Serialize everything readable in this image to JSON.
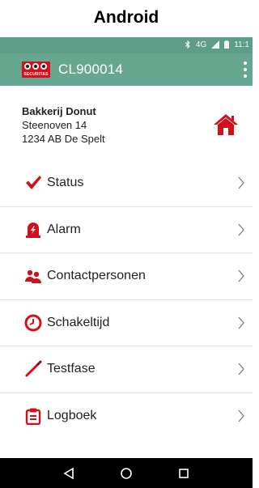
{
  "caption": "Android",
  "status_bar": {
    "bluetooth_icon": "bluetooth-icon",
    "network_label": "4G",
    "signal_icon": "signal-icon",
    "battery_icon": "battery-icon",
    "time": "11:1"
  },
  "app_bar": {
    "logo_icon": "securitas-logo",
    "logo_text": "SECURITAS",
    "title": "CL900014",
    "overflow_icon": "overflow-menu-icon"
  },
  "location": {
    "name": "Bakkerij Donut",
    "street": "Steenoven 14",
    "postal_city": "1234 AB De Spelt",
    "home_icon": "home-icon"
  },
  "menu": [
    {
      "label": "Status",
      "icon": "checkmark-icon",
      "icon_color": "#d0101b"
    },
    {
      "label": "Alarm",
      "icon": "alarm-icon",
      "icon_color": "#d0101b"
    },
    {
      "label": "Contactpersonen",
      "icon": "people-icon",
      "icon_color": "#d0101b"
    },
    {
      "label": "Schakeltijd",
      "icon": "clock-icon",
      "icon_color": "#d0101b"
    },
    {
      "label": "Testfase",
      "icon": "wand-icon",
      "icon_color": "#d0101b"
    },
    {
      "label": "Logboek",
      "icon": "clipboard-icon",
      "icon_color": "#d0101b"
    }
  ],
  "nav_bar": {
    "back_icon": "back-icon",
    "home_icon": "home-circle-icon",
    "recents_icon": "recents-icon"
  },
  "colors": {
    "accent_green": "#68a78f",
    "status_green": "#5e9e88",
    "brand_red": "#d0101b"
  }
}
